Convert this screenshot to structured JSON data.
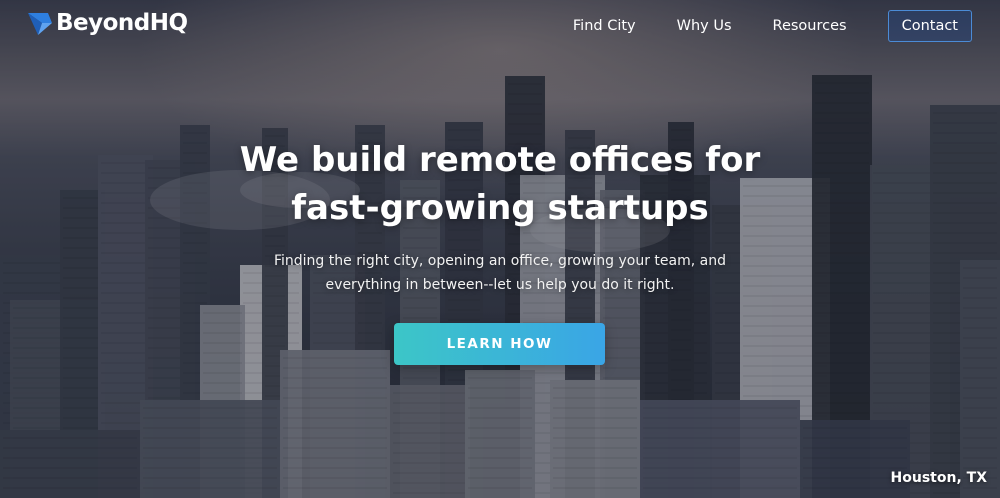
{
  "brand": {
    "name": "BeyondHQ",
    "logo_icon": "chevron-logo-icon",
    "accent": "#2e7fe0"
  },
  "nav": {
    "items": [
      {
        "label": "Find City"
      },
      {
        "label": "Why Us"
      },
      {
        "label": "Resources"
      }
    ],
    "contact_label": "Contact"
  },
  "hero": {
    "headline_line1": "We build remote offices for",
    "headline_line2": "fast-growing startups",
    "subhead_line1": "Finding the right city, opening an office, growing your team, and",
    "subhead_line2": "everything in between--let us help you do it right.",
    "cta_label": "LEARN HOW",
    "cta_colors": [
      "#3cc6c7",
      "#3aa5e6"
    ],
    "location_caption": "Houston, TX"
  }
}
